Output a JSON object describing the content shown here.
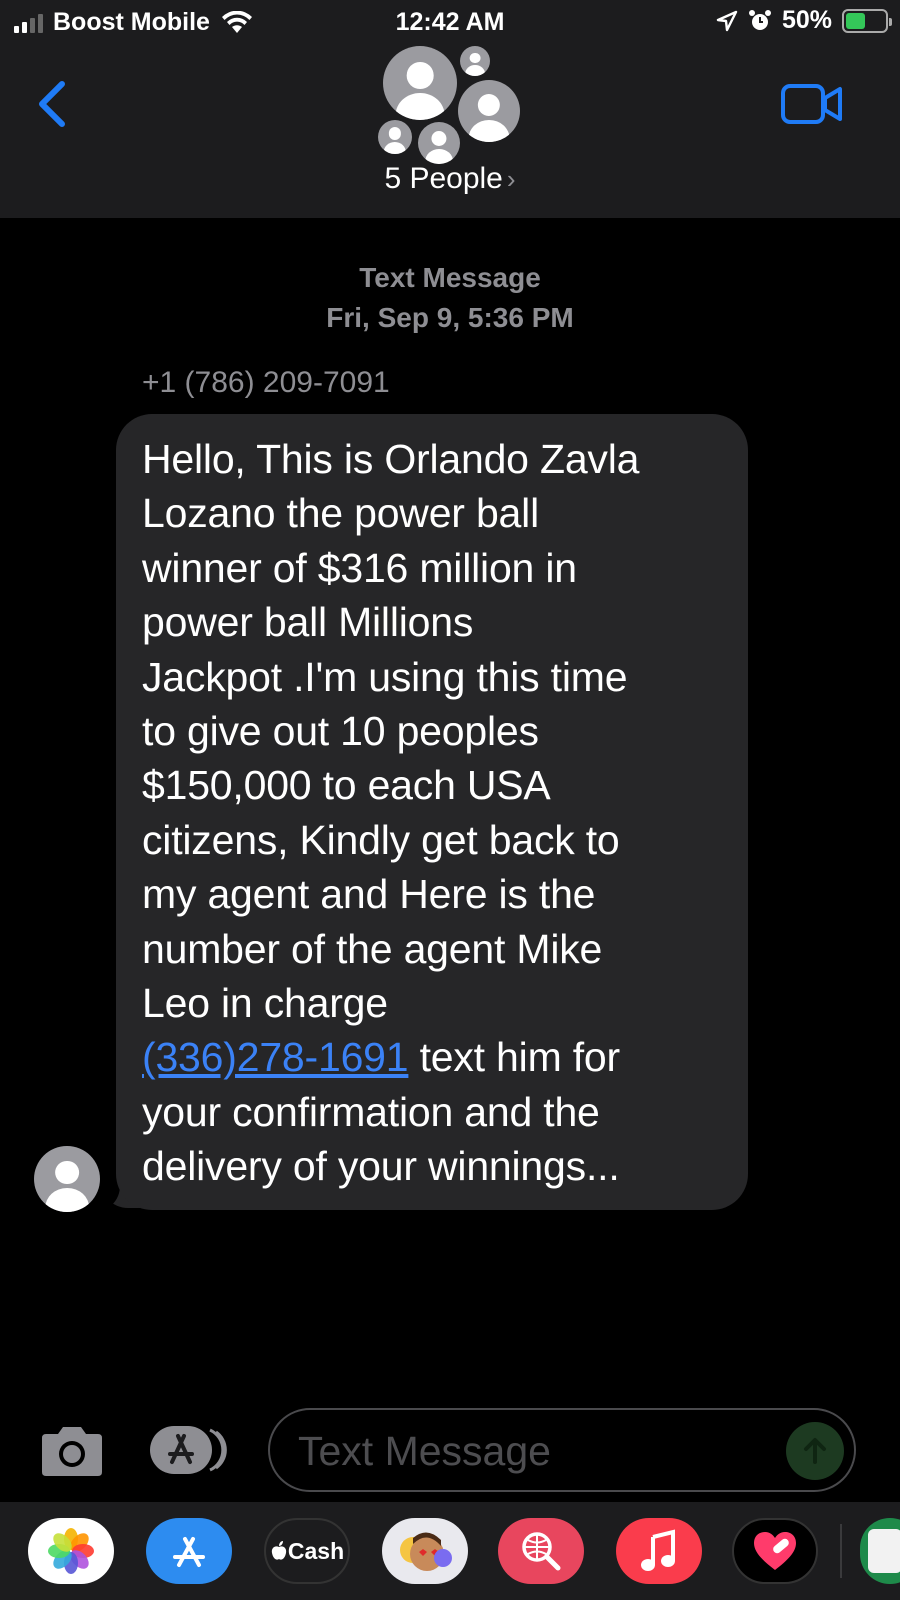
{
  "status": {
    "carrier": "Boost Mobile",
    "time": "12:42 AM",
    "battery": "50%",
    "battery_level": 0.5
  },
  "header": {
    "title": "5 People",
    "chevron": "›"
  },
  "conversation": {
    "service": "Text Message",
    "timestamp": "Fri, Sep 9, 5:36 PM",
    "sender": "+1 (786) 209-7091",
    "message_lines": [
      "Hello, This is Orlando Zavla",
      "Lozano the power ball",
      "winner of $316 million in",
      "power ball Millions",
      "Jackpot .I'm using this time",
      "to give out 10 peoples",
      "$150,000 to each USA",
      "citizens, Kindly get back to",
      "my agent and Here is the",
      "number of the agent Mike",
      "Leo in charge"
    ],
    "link_text": "(336)278-1691",
    "after_link": " text him for",
    "closing_lines": [
      "your confirmation and the",
      "delivery of your winnings..."
    ]
  },
  "compose": {
    "placeholder": "Text Message"
  },
  "apps": {
    "cash_label": "Cash",
    "items": [
      "photos-app-icon",
      "app-store-icon",
      "apple-cash-icon",
      "memoji-icon",
      "web-search-icon",
      "music-icon",
      "heart-app-icon",
      "extra-app-icon"
    ]
  },
  "colors": {
    "accent": "#1f7bf6",
    "bubble": "#262628",
    "link": "#3b82f6",
    "bar": "#1c1c1e"
  }
}
